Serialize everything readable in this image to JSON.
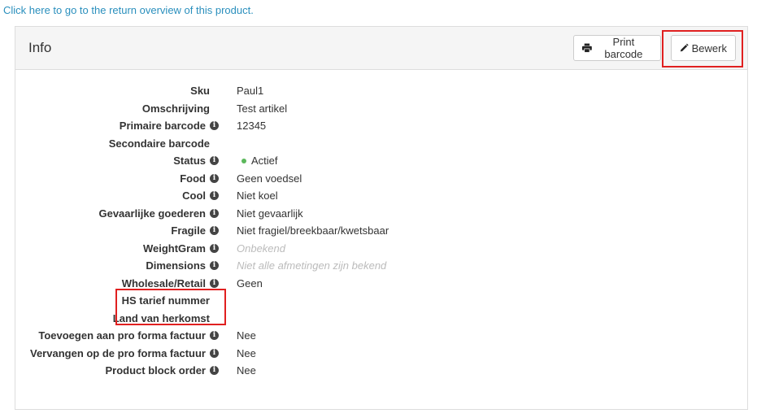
{
  "return_link": "Click here to go to the return overview of this product.",
  "panel": {
    "title": "Info",
    "print_label": "Print barcode",
    "edit_label": "Bewerk"
  },
  "fields": [
    {
      "label": "Sku",
      "value": "Paul1",
      "info": false
    },
    {
      "label": "Omschrijving",
      "value": "Test artikel",
      "info": false
    },
    {
      "label": "Primaire barcode",
      "value": "12345",
      "info": true
    },
    {
      "label": "Secondaire barcode",
      "value": "",
      "info": false
    },
    {
      "label": "Status",
      "value": "Actief",
      "info": true,
      "status_dot": true
    },
    {
      "label": "Food",
      "value": "Geen voedsel",
      "info": true
    },
    {
      "label": "Cool",
      "value": "Niet koel",
      "info": true
    },
    {
      "label": "Gevaarlijke goederen",
      "value": "Niet gevaarlijk",
      "info": true
    },
    {
      "label": "Fragile",
      "value": "Niet fragiel/breekbaar/kwetsbaar",
      "info": true
    },
    {
      "label": "WeightGram",
      "value": "Onbekend",
      "info": true,
      "muted": true
    },
    {
      "label": "Dimensions",
      "value": "Niet alle afmetingen zijn bekend",
      "info": true,
      "muted": true
    },
    {
      "label": "Wholesale/Retail",
      "value": "Geen",
      "info": true
    },
    {
      "label": "HS tarief nummer",
      "value": "",
      "info": false
    },
    {
      "label": "Land van herkomst",
      "value": "",
      "info": false
    },
    {
      "label": "Toevoegen aan pro forma factuur",
      "value": "Nee",
      "info": true
    },
    {
      "label": "Vervangen op de pro forma factuur",
      "value": "Nee",
      "info": true
    },
    {
      "label": "Product block order",
      "value": "Nee",
      "info": true
    }
  ],
  "colors": {
    "link": "#2a8fbd",
    "highlight": "#e02020",
    "status_active": "#5cb85c"
  },
  "icons": {
    "print": "printer-icon",
    "edit": "pencil-icon",
    "info": "info-circle-icon"
  }
}
